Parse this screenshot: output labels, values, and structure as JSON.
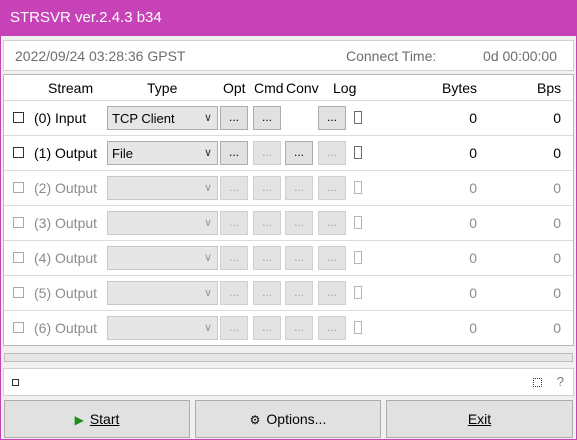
{
  "window": {
    "title": "STRSVR ver.2.4.3 b34"
  },
  "timebar": {
    "datetime": "2022/09/24 03:28:36 GPST",
    "connect_label": "Connect Time:",
    "connect_value": "0d 00:00:00"
  },
  "headers": {
    "stream": "Stream",
    "type": "Type",
    "opt": "Opt",
    "cmd": "Cmd",
    "conv": "Conv",
    "log": "Log",
    "bytes": "Bytes",
    "bps": "Bps"
  },
  "button_ellipsis": "...",
  "rows": [
    {
      "label": "(0) Input",
      "type": "TCP Client",
      "bytes": "0",
      "bps": "0"
    },
    {
      "label": "(1) Output",
      "type": "File",
      "bytes": "0",
      "bps": "0"
    },
    {
      "label": "(2) Output",
      "type": "",
      "bytes": "0",
      "bps": "0"
    },
    {
      "label": "(3) Output",
      "type": "",
      "bytes": "0",
      "bps": "0"
    },
    {
      "label": "(4) Output",
      "type": "",
      "bytes": "0",
      "bps": "0"
    },
    {
      "label": "(5) Output",
      "type": "",
      "bytes": "0",
      "bps": "0"
    },
    {
      "label": "(6) Output",
      "type": "",
      "bytes": "0",
      "bps": "0"
    }
  ],
  "progress": {
    "value": 0
  },
  "status": {
    "help": "?"
  },
  "buttons": {
    "start": "Start",
    "options": "Options...",
    "exit": "Exit"
  },
  "colors": {
    "titlebar": "#c742b6",
    "start_icon": "#1a8f1a"
  }
}
